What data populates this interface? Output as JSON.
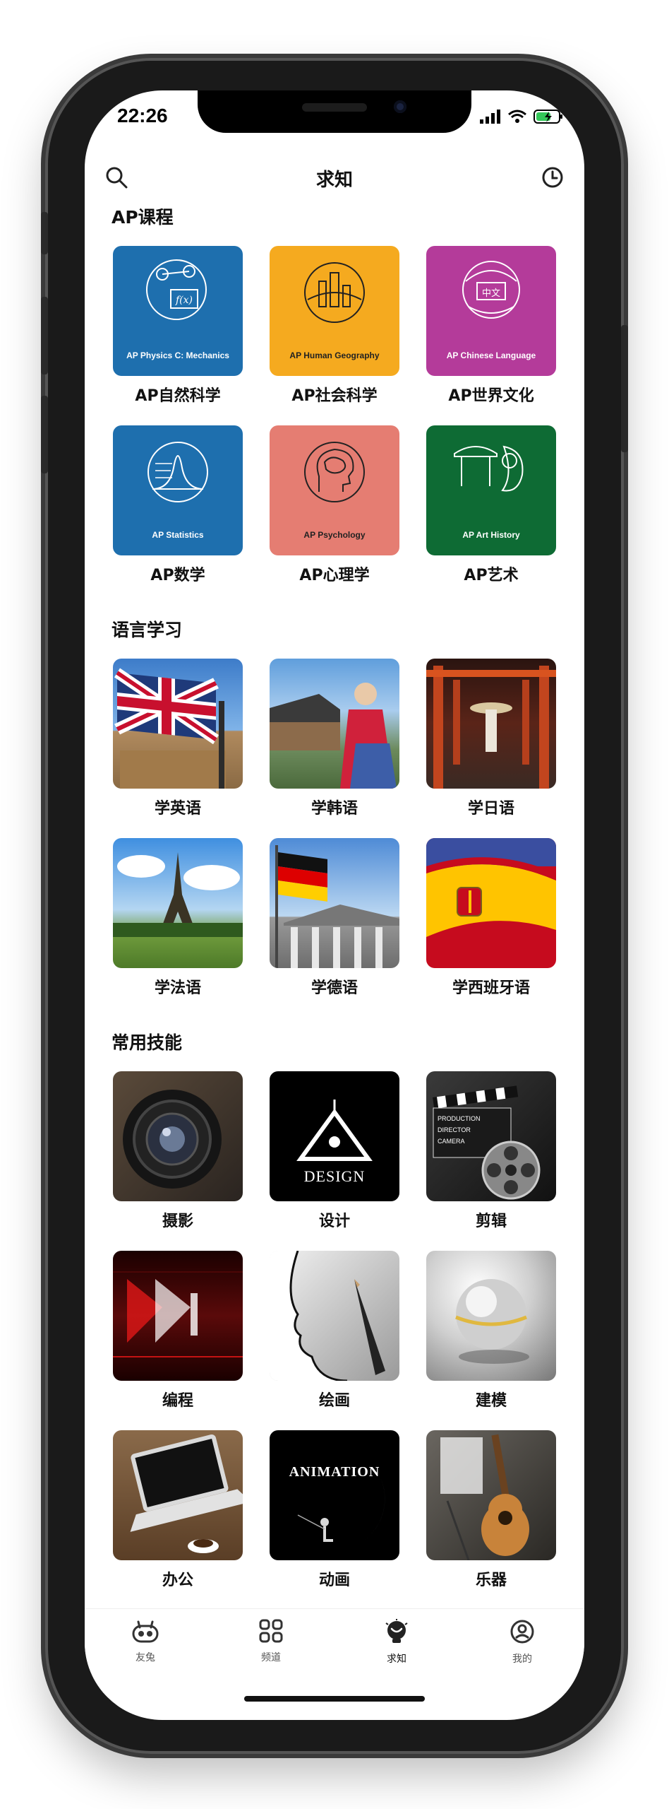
{
  "status": {
    "time": "22:26"
  },
  "nav": {
    "title": "求知"
  },
  "sections": {
    "ap": {
      "title": "AP课程",
      "tiles": [
        {
          "label": "AP自然科学",
          "badge": "AP Physics C: Mechanics",
          "color": "#1e6fae"
        },
        {
          "label": "AP社会科学",
          "badge": "AP Human Geography",
          "color": "#f5aa1f"
        },
        {
          "label": "AP世界文化",
          "badge": "AP Chinese Language",
          "color": "#b43b9a",
          "glyph": "中文"
        },
        {
          "label": "AP数学",
          "badge": "AP Statistics",
          "color": "#1e6fae"
        },
        {
          "label": "AP心理学",
          "badge": "AP Psychology",
          "color": "#e57d72"
        },
        {
          "label": "AP艺术",
          "badge": "AP Art History",
          "color": "#0e6b34"
        }
      ]
    },
    "language": {
      "title": "语言学习",
      "tiles": [
        {
          "label": "学英语"
        },
        {
          "label": "学韩语"
        },
        {
          "label": "学日语"
        },
        {
          "label": "学法语"
        },
        {
          "label": "学德语"
        },
        {
          "label": "学西班牙语"
        }
      ]
    },
    "skills": {
      "title": "常用技能",
      "tiles": [
        {
          "label": "摄影"
        },
        {
          "label": "设计",
          "overlay": "DESIGN"
        },
        {
          "label": "剪辑"
        },
        {
          "label": "编程"
        },
        {
          "label": "绘画"
        },
        {
          "label": "建模"
        },
        {
          "label": "办公"
        },
        {
          "label": "动画",
          "overlay": "ANIMATION"
        },
        {
          "label": "乐器"
        }
      ]
    }
  },
  "tabbar": [
    {
      "label": "友兔",
      "icon": "rabbit-icon"
    },
    {
      "label": "频道",
      "icon": "grid-icon"
    },
    {
      "label": "求知",
      "icon": "bulb-icon",
      "active": true
    },
    {
      "label": "我的",
      "icon": "user-icon"
    }
  ]
}
